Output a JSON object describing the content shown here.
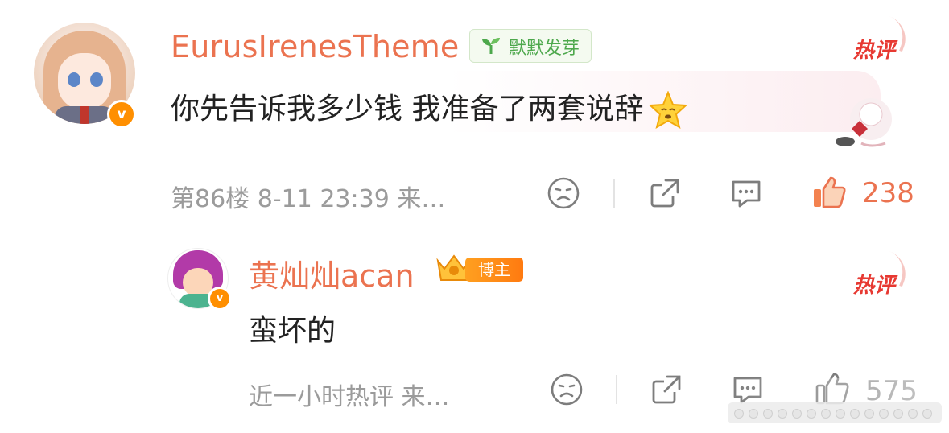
{
  "comments": [
    {
      "user": "EurusIrenesTheme",
      "badge": "默默发芽",
      "hot_label": "热评",
      "text": "你先告诉我多少钱 我准备了两套说辞",
      "meta": "第86楼 8-11 23:39 来…",
      "likes": "238",
      "liked": true
    }
  ],
  "reply": {
    "user": "黄灿灿acan",
    "badge": "博主",
    "hot_label": "热评",
    "text": "蛮坏的",
    "meta": "近一小时热评 来…",
    "likes": "575"
  },
  "colors": {
    "name": "#eb7350",
    "hot": "#e73932",
    "like_active": "#eb7350",
    "meta": "#9b9b9b",
    "badge_green": "#4da84c",
    "blogger_orange": "#ff8a10"
  },
  "icons": [
    "verified-icon",
    "sprout-icon",
    "dislike-icon",
    "share-icon",
    "comment-icon",
    "like-icon",
    "blogger-crown-icon",
    "star-emoji-icon"
  ]
}
